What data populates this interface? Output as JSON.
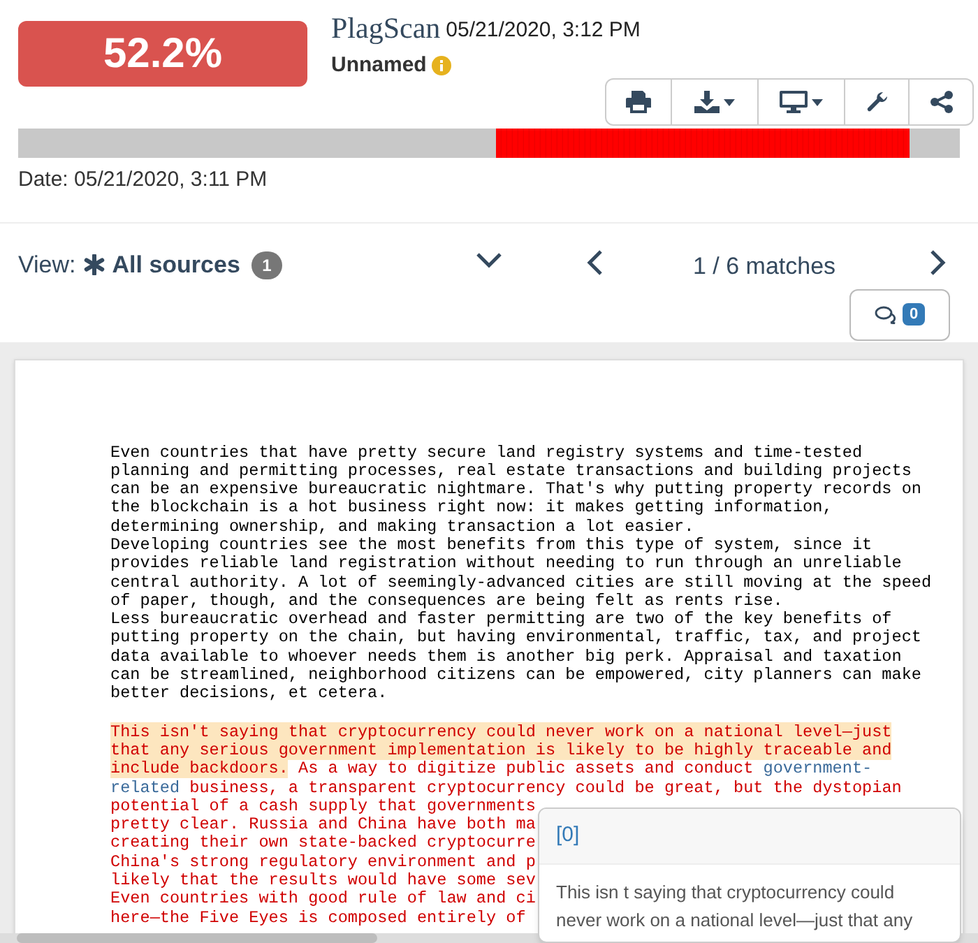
{
  "header": {
    "score": "52.2%",
    "logo": "PlagScan",
    "report_date": "05/21/2020, 3:12 PM",
    "document_name": "Unnamed",
    "date": "Date: 05/21/2020, 3:11 PM"
  },
  "toolbar": [
    {
      "kind": "print",
      "dropdown": false
    },
    {
      "kind": "download",
      "dropdown": true
    },
    {
      "kind": "display",
      "dropdown": true
    },
    {
      "kind": "settings",
      "dropdown": false
    },
    {
      "kind": "share",
      "dropdown": false
    }
  ],
  "view": {
    "label": "View:",
    "source": "All sources",
    "count": "1",
    "matches": "1 / 6 matches",
    "comments": "0"
  },
  "document": {
    "paragraphs": [
      {
        "lines": [
          [
            {
              "kind": "plain",
              "text": "Even countries that have pretty secure land registry systems and time-tested",
              "highlighted": false
            }
          ],
          [
            {
              "kind": "plain",
              "text": "planning and permitting processes, real estate transactions and building projects",
              "highlighted": false
            }
          ],
          [
            {
              "kind": "plain",
              "text": "can be an expensive bureaucratic nightmare. That's why putting property records on",
              "highlighted": false
            }
          ],
          [
            {
              "kind": "plain",
              "text": "the blockchain is a hot business right now: it makes getting information,",
              "highlighted": false
            }
          ],
          [
            {
              "kind": "plain",
              "text": "determining ownership, and making transaction a lot easier.",
              "highlighted": false
            }
          ],
          [
            {
              "kind": "plain",
              "text": "Developing countries see the most benefits from this type of system, since it",
              "highlighted": false
            }
          ],
          [
            {
              "kind": "plain",
              "text": "provides reliable land registration without needing to run through an unreliable",
              "highlighted": false
            }
          ],
          [
            {
              "kind": "plain",
              "text": "central authority. A lot of seemingly-advanced cities are still moving at the speed",
              "highlighted": false
            }
          ],
          [
            {
              "kind": "plain",
              "text": "of paper, though, and the consequences are being felt as rents rise.",
              "highlighted": false
            }
          ],
          [
            {
              "kind": "plain",
              "text": "Less bureaucratic overhead and faster permitting are two of the key benefits of",
              "highlighted": false
            }
          ],
          [
            {
              "kind": "plain",
              "text": "putting property on the chain, but having environmental, traffic, tax, and project",
              "highlighted": false
            }
          ],
          [
            {
              "kind": "plain",
              "text": "data available to whoever needs them is another big perk. Appraisal and taxation",
              "highlighted": false
            }
          ],
          [
            {
              "kind": "plain",
              "text": "can be streamlined, neighborhood citizens can be empowered, city planners can make",
              "highlighted": false
            }
          ],
          [
            {
              "kind": "plain",
              "text": "better decisions, et cetera.",
              "highlighted": false
            }
          ]
        ]
      },
      {
        "lines": [
          [
            {
              "kind": "match",
              "text": "This isn't saying that cryptocurrency could never work on a national level—just",
              "highlighted": true
            }
          ],
          [
            {
              "kind": "match",
              "text": "that any serious government implementation is likely to be highly traceable and",
              "highlighted": true
            }
          ],
          [
            {
              "kind": "match",
              "text": "include backdoors.",
              "highlighted": true
            },
            {
              "kind": "match",
              "text": " As a way to digitize public assets and conduct ",
              "highlighted": false
            },
            {
              "kind": "link",
              "text": "government-",
              "highlighted": false
            }
          ],
          [
            {
              "kind": "link",
              "text": "related",
              "highlighted": false
            },
            {
              "kind": "match",
              "text": " business, a transparent cryptocurrency could be great, but the dystopian",
              "highlighted": false
            }
          ],
          [
            {
              "kind": "match",
              "text": "potential of a cash supply that governments",
              "highlighted": false
            }
          ],
          [
            {
              "kind": "match",
              "text": "pretty clear. Russia and China have both ma",
              "highlighted": false
            }
          ],
          [
            {
              "kind": "match",
              "text": "creating their own state-backed cryptocurre",
              "highlighted": false
            }
          ],
          [
            {
              "kind": "match",
              "text": "China's strong regulatory environment and p",
              "highlighted": false
            }
          ],
          [
            {
              "kind": "match",
              "text": "likely that the results would have some sev",
              "highlighted": false
            }
          ],
          [
            {
              "kind": "match",
              "text": "Even countries with good rule of law and ci",
              "highlighted": false
            }
          ],
          [
            {
              "kind": "match",
              "text": "here—the Five Eyes is composed entirely of",
              "highlighted": false
            }
          ]
        ]
      }
    ]
  },
  "popover": {
    "title": "[0]",
    "lines": [
      "This isn t saying that cryptocurrency could",
      "never work on a national level—just that any"
    ]
  }
}
